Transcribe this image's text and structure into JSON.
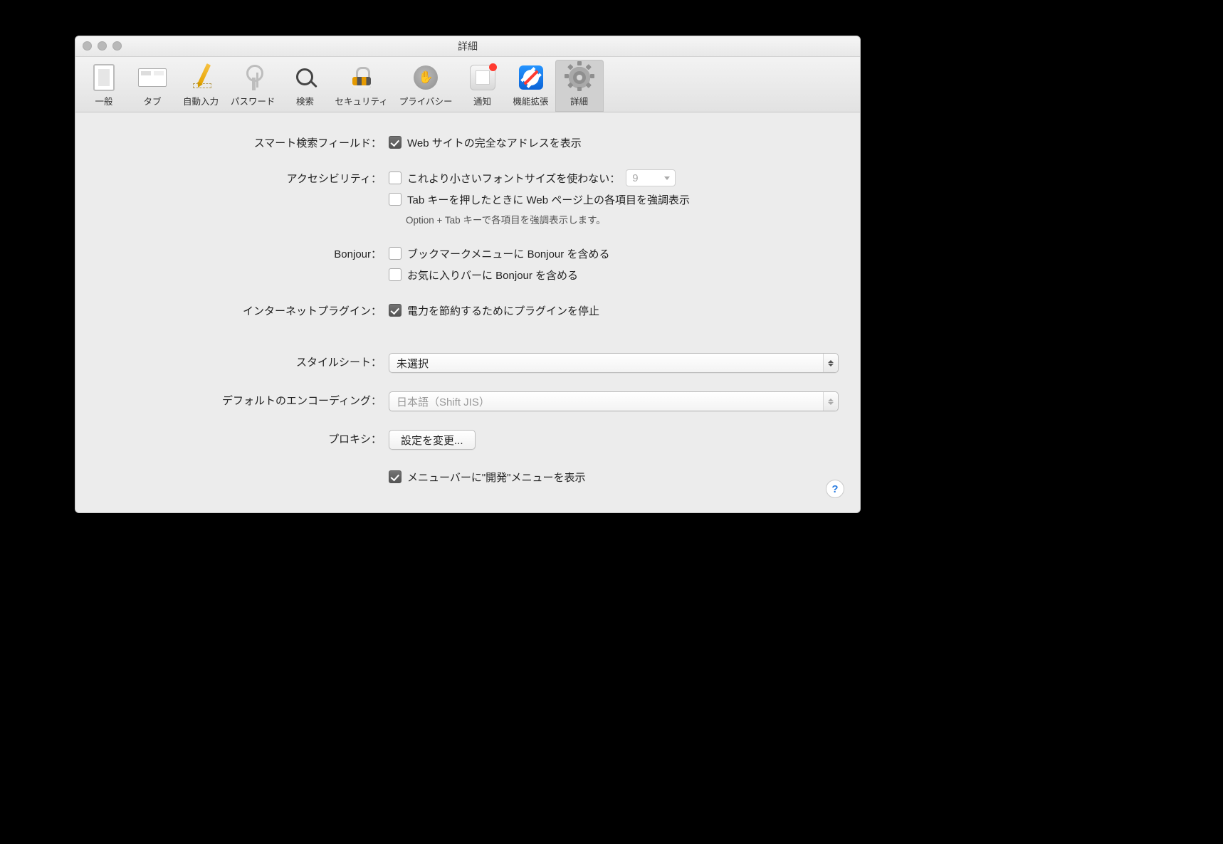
{
  "window": {
    "title": "詳細"
  },
  "toolbar": {
    "items": [
      {
        "label": "一般"
      },
      {
        "label": "タブ"
      },
      {
        "label": "自動入力"
      },
      {
        "label": "パスワード"
      },
      {
        "label": "検索"
      },
      {
        "label": "セキュリティ"
      },
      {
        "label": "プライバシー"
      },
      {
        "label": "通知"
      },
      {
        "label": "機能拡張"
      },
      {
        "label": "詳細"
      }
    ]
  },
  "labels": {
    "smart_search": "スマート検索フィールド：",
    "accessibility": "アクセシビリティ：",
    "bonjour": "Bonjour：",
    "plugins": "インターネットプラグイン：",
    "stylesheet": "スタイルシート：",
    "encoding": "デフォルトのエンコーディング：",
    "proxy": "プロキシ："
  },
  "options": {
    "show_full_address": "Web サイトの完全なアドレスを表示",
    "min_font": "これより小さいフォントサイズを使わない：",
    "min_font_value": "9",
    "tab_highlight": "Tab キーを押したときに Web ページ上の各項目を強調表示",
    "tab_hint": "Option + Tab キーで各項目を強調表示します。",
    "bonjour_bookmarks": "ブックマークメニューに Bonjour を含める",
    "bonjour_favs": "お気に入りバーに Bonjour を含める",
    "plugin_power": "電力を節約するためにプラグインを停止",
    "stylesheet_value": "未選択",
    "encoding_value": "日本語（Shift JIS）",
    "proxy_button": "設定を変更...",
    "develop_menu": "メニューバーに\"開発\"メニューを表示"
  },
  "help": "?"
}
